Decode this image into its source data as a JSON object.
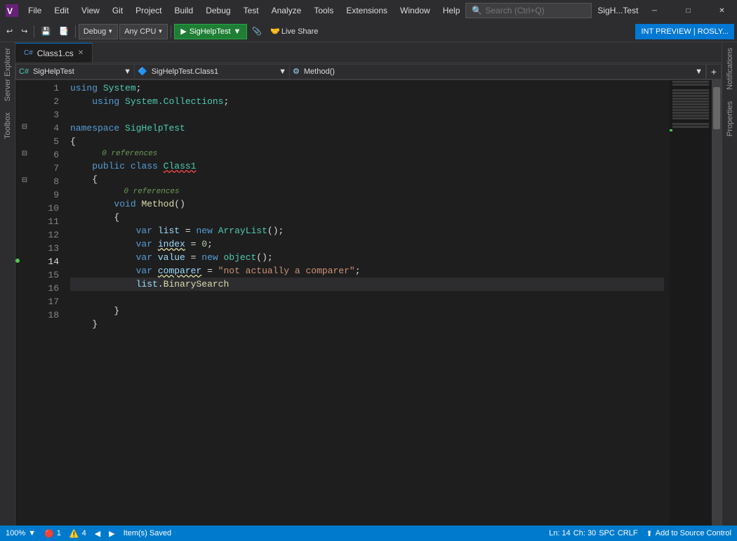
{
  "title_bar": {
    "logo": "VS",
    "menus": [
      "File",
      "Edit",
      "View",
      "Git",
      "Project",
      "Build",
      "Debug",
      "Test",
      "Analyze",
      "Tools",
      "Extensions",
      "Window",
      "Help"
    ],
    "search_placeholder": "Search (Ctrl+Q)",
    "window_title": "SigH...Test",
    "min_label": "─",
    "max_label": "□",
    "close_label": "✕"
  },
  "toolbar": {
    "back_label": "◀",
    "forward_label": "▶",
    "undo_label": "↩",
    "redo_label": "↪",
    "config_label": "Debug",
    "platform_label": "Any CPU",
    "run_label": "▶",
    "run_target": "SigHelpTest",
    "live_share_label": "Live Share",
    "int_preview_label": "INT PREVIEW | ROSLY..."
  },
  "tab": {
    "name": "Class1.cs",
    "icon": "C#",
    "modified": false
  },
  "nav_bar": {
    "project": "SigHelpTest",
    "class": "SigHelpTest.Class1",
    "method": "Method()"
  },
  "code": {
    "lines": [
      {
        "num": 1,
        "indent": 0,
        "content": "using System;",
        "tokens": [
          {
            "type": "kw",
            "text": "using"
          },
          {
            "type": "punct",
            "text": " "
          },
          {
            "type": "type",
            "text": "System"
          },
          {
            "type": "punct",
            "text": ";"
          }
        ]
      },
      {
        "num": 2,
        "indent": 1,
        "content": "    using System.Collections;",
        "tokens": [
          {
            "type": "kw",
            "text": "using"
          },
          {
            "type": "punct",
            "text": " "
          },
          {
            "type": "type",
            "text": "System.Collections"
          },
          {
            "type": "punct",
            "text": ";"
          }
        ]
      },
      {
        "num": 3,
        "indent": 0,
        "content": "",
        "tokens": []
      },
      {
        "num": 4,
        "indent": 0,
        "content": "namespace SigHelpTest",
        "tokens": [
          {
            "type": "kw",
            "text": "namespace"
          },
          {
            "type": "punct",
            "text": " "
          },
          {
            "type": "type",
            "text": "SigHelpTest"
          }
        ],
        "foldable": true
      },
      {
        "num": 5,
        "indent": 0,
        "content": "{",
        "tokens": [
          {
            "type": "punct",
            "text": "{"
          }
        ]
      },
      {
        "num": 6,
        "indent": 1,
        "ref": "0 references",
        "content": "    public class Class1",
        "tokens": [
          {
            "type": "kw",
            "text": "public"
          },
          {
            "type": "punct",
            "text": " "
          },
          {
            "type": "kw",
            "text": "class"
          },
          {
            "type": "punct",
            "text": " "
          },
          {
            "type": "type",
            "text": "Class1",
            "squiggle": true
          }
        ],
        "foldable": true
      },
      {
        "num": 7,
        "indent": 1,
        "content": "    {",
        "tokens": [
          {
            "type": "punct",
            "text": "{"
          }
        ]
      },
      {
        "num": 8,
        "indent": 2,
        "ref": "0 references",
        "content": "        void Method()",
        "tokens": [
          {
            "type": "kw",
            "text": "void"
          },
          {
            "type": "punct",
            "text": " "
          },
          {
            "type": "method-name",
            "text": "Method"
          },
          {
            "type": "punct",
            "text": "()"
          }
        ],
        "foldable": true
      },
      {
        "num": 9,
        "indent": 2,
        "content": "        {",
        "tokens": [
          {
            "type": "punct",
            "text": "{"
          }
        ]
      },
      {
        "num": 10,
        "indent": 3,
        "content": "            var list = new ArrayList();",
        "tokens": [
          {
            "type": "kw",
            "text": "var"
          },
          {
            "type": "punct",
            "text": " "
          },
          {
            "type": "var",
            "text": "list"
          },
          {
            "type": "punct",
            "text": " = "
          },
          {
            "type": "kw",
            "text": "new"
          },
          {
            "type": "punct",
            "text": " "
          },
          {
            "type": "type",
            "text": "ArrayList"
          },
          {
            "type": "punct",
            "text": "();"
          }
        ]
      },
      {
        "num": 11,
        "indent": 3,
        "content": "            var index = 0;",
        "tokens": [
          {
            "type": "kw",
            "text": "var"
          },
          {
            "type": "punct",
            "text": " "
          },
          {
            "type": "var",
            "text": "index",
            "squiggle2": true
          },
          {
            "type": "punct",
            "text": " = "
          },
          {
            "type": "number",
            "text": "0"
          },
          {
            "type": "punct",
            "text": ";"
          }
        ]
      },
      {
        "num": 12,
        "indent": 3,
        "content": "            var value = new object();",
        "tokens": [
          {
            "type": "kw",
            "text": "var"
          },
          {
            "type": "punct",
            "text": " "
          },
          {
            "type": "var",
            "text": "value"
          },
          {
            "type": "punct",
            "text": " = "
          },
          {
            "type": "kw",
            "text": "new"
          },
          {
            "type": "punct",
            "text": " "
          },
          {
            "type": "type",
            "text": "object"
          },
          {
            "type": "punct",
            "text": "();"
          }
        ]
      },
      {
        "num": 13,
        "indent": 3,
        "content": "            var comparer = \"not actually a comparer\";",
        "tokens": [
          {
            "type": "kw",
            "text": "var"
          },
          {
            "type": "punct",
            "text": " "
          },
          {
            "type": "var",
            "text": "comparer",
            "squiggle2": true
          },
          {
            "type": "punct",
            "text": " = "
          },
          {
            "type": "string",
            "text": "\"not actually a comparer\""
          },
          {
            "type": "punct",
            "text": ";"
          }
        ]
      },
      {
        "num": 14,
        "indent": 3,
        "content": "            list.BinarySearch",
        "tokens": [
          {
            "type": "var",
            "text": "list"
          },
          {
            "type": "punct",
            "text": "."
          },
          {
            "type": "method-name",
            "text": "BinarySearch"
          }
        ],
        "current": true,
        "has_indicator": true
      },
      {
        "num": 15,
        "indent": 3,
        "content": "",
        "tokens": []
      },
      {
        "num": 16,
        "indent": 2,
        "content": "        }",
        "tokens": [
          {
            "type": "punct",
            "text": "}"
          }
        ]
      },
      {
        "num": 17,
        "indent": 1,
        "content": "    }",
        "tokens": [
          {
            "type": "punct",
            "text": "}"
          }
        ]
      },
      {
        "num": 18,
        "indent": 0,
        "content": "",
        "tokens": []
      }
    ]
  },
  "status_bar": {
    "zoom": "100%",
    "errors": "1",
    "warnings": "4",
    "nav_back": "◀",
    "nav_forward": "▶",
    "bookmark": "🔖",
    "ln": "Ln: 14",
    "ch": "Ch: 30",
    "spc": "SPC",
    "eol": "CRLF",
    "status_text": "Item(s) Saved",
    "source_control": "Add to Source Control"
  }
}
